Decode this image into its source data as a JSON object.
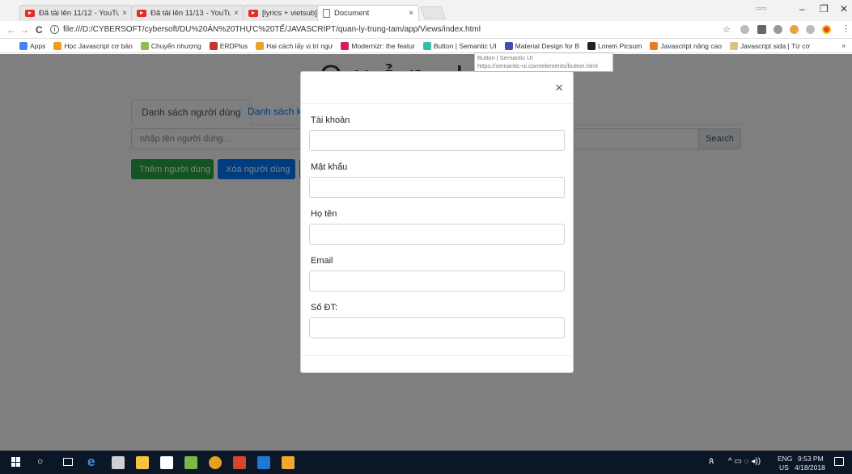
{
  "browser": {
    "tabs": [
      {
        "title": "Đã tải lên 11/12 - YouTu",
        "close": "×",
        "favicon": "youtube-icon"
      },
      {
        "title": "Đã tải lên 11/13 - YouTu",
        "close": "×",
        "favicon": "youtube-icon"
      },
      {
        "title": "[lyrics + vietsub] Họa",
        "close": "×",
        "favicon": "youtube-icon"
      },
      {
        "title": "Document",
        "close": "×",
        "favicon": "document-icon"
      }
    ],
    "window_controls": {
      "minimize": "–",
      "maximize": "❐",
      "close": "✕"
    },
    "nav": {
      "back": "←",
      "forward": "→",
      "reload": "C"
    },
    "url": "file:///D:/CYBERSOFT/cybersoft/DU%20ÁN%20THỰC%20TẾ/JAVASCRIPT/quan-ly-trung-tam/app/Views/index.html",
    "bookmarks": [
      {
        "label": "Apps",
        "icon": "apps-grid-icon",
        "color": "#4285f4"
      },
      {
        "label": "Học Javascript cơ bản",
        "icon": "j-icon",
        "color": "#f39c12"
      },
      {
        "label": "Chuyển nhượng",
        "icon": "leaf-icon",
        "color": "#8bc34a"
      },
      {
        "label": "ERDPlus",
        "icon": "er-icon",
        "color": "#c0392b"
      },
      {
        "label": "Hai cách lấy vị trí ngư",
        "icon": "js-icon",
        "color": "#f0a030"
      },
      {
        "label": "Modernizr: the featur",
        "icon": "modernizr-icon",
        "color": "#d81b60"
      },
      {
        "label": "Button | Semantic UI",
        "icon": "semantic-icon",
        "color": "#35bdb2"
      },
      {
        "label": "Material Design for B",
        "icon": "mdb-icon",
        "color": "#3f51b5"
      },
      {
        "label": "Lorem Picsum",
        "icon": "u-icon",
        "color": "#222222"
      },
      {
        "label": "Javascript nâng cao",
        "icon": "vj-icon",
        "color": "#e67e22"
      },
      {
        "label": "Javascript sida | Từ cơ",
        "icon": "face-icon",
        "color": "#e0c080"
      }
    ],
    "bookmarks_more": "»",
    "tooltip": {
      "title": "Button | Semantic UI",
      "url": "https://semantic-ui.com/elements/button.html"
    }
  },
  "page": {
    "heading": "Quản Lý T",
    "tabs": [
      {
        "label": "Danh sách người dùng"
      },
      {
        "label": "Danh sách kh"
      }
    ],
    "search": {
      "placeholder": "nhập tên người dùng...",
      "button": "Search"
    },
    "buttons": {
      "add": "Thêm người dùng",
      "delete": "Xóa người dùng"
    }
  },
  "modal": {
    "close": "×",
    "fields": [
      {
        "label": "Tài khoản",
        "value": ""
      },
      {
        "label": "Mật khẩu",
        "value": ""
      },
      {
        "label": "Họ tên",
        "value": ""
      },
      {
        "label": "Email",
        "value": ""
      },
      {
        "label": "Số ĐT:",
        "value": ""
      }
    ]
  },
  "taskbar": {
    "language": "ENG",
    "region": "US",
    "time": "9:53 PM",
    "date": "4/18/2018"
  }
}
